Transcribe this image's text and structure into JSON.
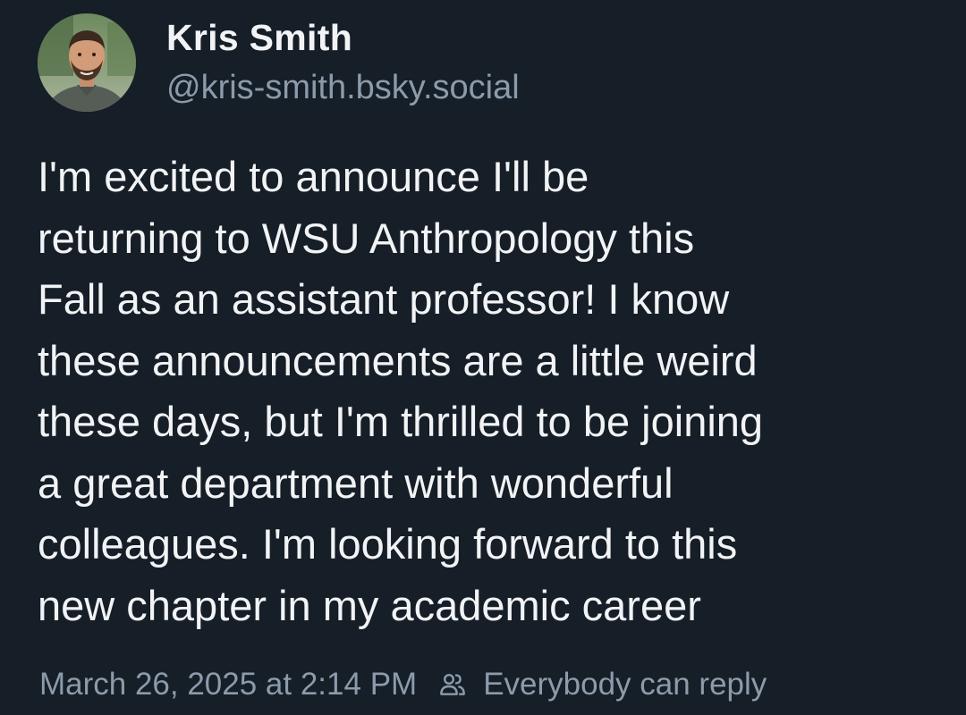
{
  "author": {
    "display_name": "Kris Smith",
    "handle": "@kris-smith.bsky.social",
    "avatar_icon": "profile-photo"
  },
  "post": {
    "lines": [
      "I'm excited to announce I'll be",
      "returning to WSU Anthropology this",
      "Fall as an assistant professor! I know",
      "these announcements are a little weird",
      "these days, but I'm thrilled to be joining",
      "a great department with wonderful",
      "colleagues. I'm looking forward to this",
      "new chapter in my academic career"
    ]
  },
  "footer": {
    "timestamp": "March 26, 2025 at 2:14 PM",
    "reply_setting": "Everybody can reply",
    "reply_icon": "people-icon"
  },
  "colors": {
    "background": "#161e27",
    "primary_text": "#f1f3f5",
    "secondary_text": "#8c9bab"
  }
}
